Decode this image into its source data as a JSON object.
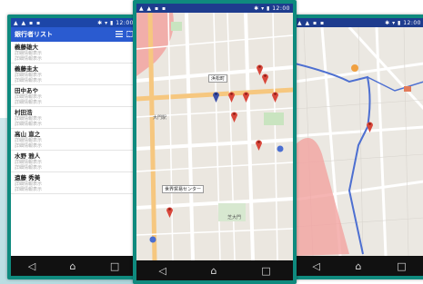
{
  "colors": {
    "frame": "#0f8a7e",
    "appbar": "#2a5bd0",
    "pin_red": "#d8463a",
    "pin_blue": "#3b4fa8",
    "route": "#4d6fd1",
    "zone": "#f2a3a0"
  },
  "phone1": {
    "status": {
      "left": "▲ ▲ ▪ ▪",
      "right": "✱ ▾ ▮ 12:00"
    },
    "app_title": "銀行者リスト",
    "icons": [
      "list-icon",
      "map-icon"
    ],
    "items": [
      {
        "name": "義藤雄大",
        "sub": "詳細情報表示"
      },
      {
        "name": "義藤圭太",
        "sub": "詳細情報表示"
      },
      {
        "name": "田中あや",
        "sub": "詳細情報表示"
      },
      {
        "name": "村田浩",
        "sub": "詳細情報表示"
      },
      {
        "name": "高山 直之",
        "sub": "詳細情報表示"
      },
      {
        "name": "水野 雅人",
        "sub": "詳細情報表示"
      },
      {
        "name": "遠藤 秀美",
        "sub": "詳細情報表示"
      }
    ],
    "nav": {
      "back": "◁",
      "home": "⌂",
      "recent": "□"
    }
  },
  "phone2": {
    "status": {
      "left": "▲ ▲ ▪ ▪",
      "right": "✱ ▾ ▮ 12:00"
    },
    "labels": [
      {
        "text": "浜松町"
      },
      {
        "text": "大門駅"
      },
      {
        "text": "世界貿易センター"
      },
      {
        "text": "芝大門"
      }
    ],
    "nav": {
      "back": "◁",
      "home": "⌂",
      "recent": "□"
    }
  },
  "phone3": {
    "status": {
      "left": "▲ ▲ ▪ ▪",
      "right": "✱ ▾ ▮ 12:00"
    },
    "nav": {
      "back": "◁",
      "home": "⌂",
      "recent": "□"
    }
  }
}
